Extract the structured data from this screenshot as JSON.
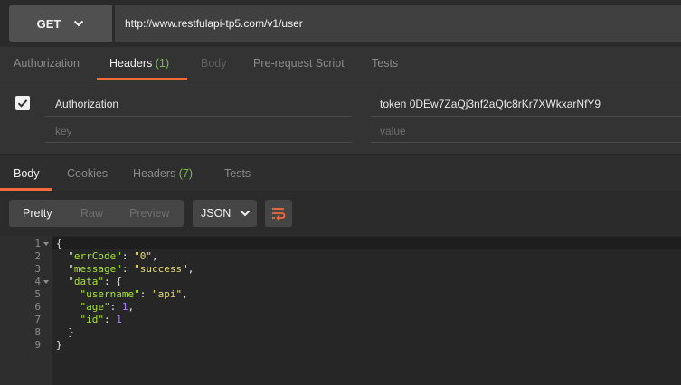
{
  "request": {
    "method": "GET",
    "url": "http://www.restfulapi-tp5.com/v1/user"
  },
  "request_tabs": {
    "authorization": "Authorization",
    "headers": "Headers",
    "headers_count": "(1)",
    "body": "Body",
    "prerequest": "Pre-request Script",
    "tests": "Tests"
  },
  "headers_table": {
    "row": {
      "key": "Authorization",
      "value": "token 0DEw7ZaQj3nf2aQfc8rKr7XWkxarNfY9",
      "enabled": true
    },
    "new_row": {
      "key_placeholder": "key",
      "value_placeholder": "value"
    }
  },
  "response_tabs": {
    "body": "Body",
    "cookies": "Cookies",
    "headers": "Headers",
    "headers_count": "(7)",
    "tests": "Tests"
  },
  "toolbar": {
    "pretty": "Pretty",
    "raw": "Raw",
    "preview": "Preview",
    "format": "JSON"
  },
  "code": {
    "line_numbers": [
      "1",
      "2",
      "3",
      "4",
      "5",
      "6",
      "7",
      "8",
      "9"
    ],
    "lines": [
      [
        [
          "p",
          "{"
        ]
      ],
      [
        [
          "p",
          "  "
        ],
        [
          "k",
          "\"errCode\""
        ],
        [
          "p",
          ": "
        ],
        [
          "s",
          "\"0\""
        ],
        [
          "p",
          ","
        ]
      ],
      [
        [
          "p",
          "  "
        ],
        [
          "k",
          "\"message\""
        ],
        [
          "p",
          ": "
        ],
        [
          "s",
          "\"success\""
        ],
        [
          "p",
          ","
        ]
      ],
      [
        [
          "p",
          "  "
        ],
        [
          "k",
          "\"data\""
        ],
        [
          "p",
          ": {"
        ]
      ],
      [
        [
          "p",
          "    "
        ],
        [
          "k",
          "\"username\""
        ],
        [
          "p",
          ": "
        ],
        [
          "s",
          "\"api\""
        ],
        [
          "p",
          ","
        ]
      ],
      [
        [
          "p",
          "    "
        ],
        [
          "k",
          "\"age\""
        ],
        [
          "p",
          ": "
        ],
        [
          "n",
          "1"
        ],
        [
          "p",
          ","
        ]
      ],
      [
        [
          "p",
          "    "
        ],
        [
          "k",
          "\"id\""
        ],
        [
          "p",
          ": "
        ],
        [
          "n",
          "1"
        ]
      ],
      [
        [
          "p",
          "  }"
        ]
      ],
      [
        [
          "p",
          "}"
        ]
      ]
    ]
  },
  "colors": {
    "accent": "#f26b3a",
    "count_green": "#71bf4a",
    "json_key": "#a6e22e",
    "json_string": "#e6db74",
    "json_number": "#ae81ff"
  }
}
